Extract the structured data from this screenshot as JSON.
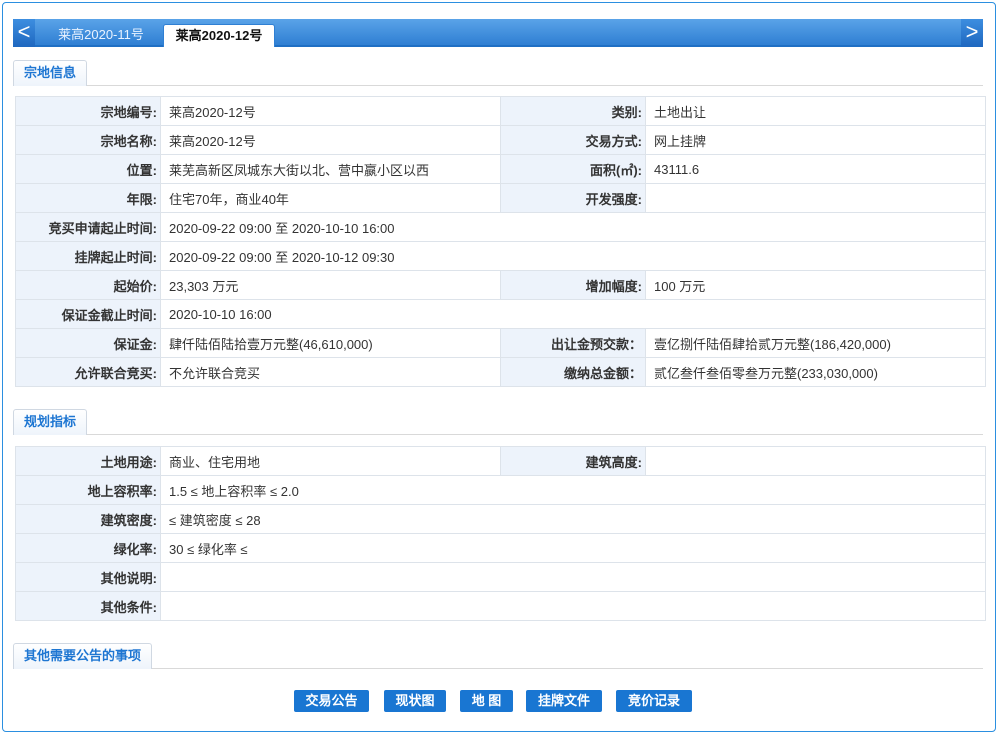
{
  "tabs": [
    {
      "label": "莱高2020-11号"
    },
    {
      "label": "莱高2020-12号"
    }
  ],
  "nav": {
    "prev": "<",
    "next": ">"
  },
  "sections": {
    "basic": "宗地信息",
    "planning": "规划指标",
    "other": "其他需要公告的事项"
  },
  "basic": {
    "parcel_no_label": "宗地编号:",
    "parcel_no": "莱高2020-12号",
    "category_label": "类别:",
    "category": "土地出让",
    "parcel_name_label": "宗地名称:",
    "parcel_name": "莱高2020-12号",
    "trade_mode_label": "交易方式:",
    "trade_mode": "网上挂牌",
    "location_label": "位置:",
    "location": "莱芜高新区凤城东大街以北、营中嬴小区以西",
    "area_label": "面积(㎡):",
    "area": "43111.6",
    "term_label": "年限:",
    "term": "住宅70年，商业40年",
    "intensity_label": "开发强度:",
    "intensity": "",
    "bid_apply_label": "竞买申请起止时间:",
    "bid_apply": "2020-09-22 09:00 至 2020-10-10 16:00",
    "listing_label": "挂牌起止时间:",
    "listing": "2020-09-22 09:00 至 2020-10-12 09:30",
    "start_price_label": "起始价:",
    "start_price": "23,303 万元",
    "increment_label": "增加幅度:",
    "increment": "100 万元",
    "deposit_deadline_label": "保证金截止时间:",
    "deposit_deadline": "2020-10-10 16:00",
    "deposit_label": "保证金:",
    "deposit": "肆仟陆佰陆拾壹万元整(46,610,000)",
    "prepay_label": "出让金预交款：",
    "prepay": "壹亿捌仟陆佰肆拾贰万元整(186,420,000)",
    "joint_label": "允许联合竞买:",
    "joint": "不允许联合竞买",
    "total_label": "缴纳总金额：",
    "total": "贰亿叁仟叁佰零叁万元整(233,030,000)"
  },
  "planning": {
    "use_label": "土地用途:",
    "use": "商业、住宅用地",
    "height_label": "建筑高度:",
    "height": "",
    "far_label": "地上容积率:",
    "far": "1.5 ≤ 地上容积率 ≤ 2.0",
    "density_label": "建筑密度:",
    "density": "≤ 建筑密度 ≤ 28",
    "green_label": "绿化率:",
    "green": "30 ≤ 绿化率 ≤",
    "notes_label": "其他说明:",
    "notes": "",
    "conditions_label": "其他条件:",
    "conditions": ""
  },
  "buttons": {
    "announcement": "交易公告",
    "status_map": "现状图",
    "map": "地 图",
    "listing_docs": "挂牌文件",
    "bid_records": "竞价记录"
  }
}
